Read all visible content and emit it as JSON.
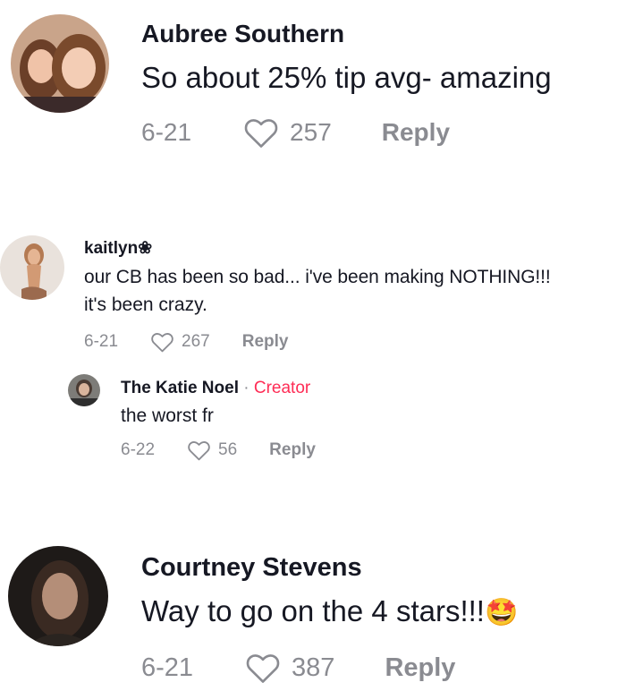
{
  "comments": [
    {
      "username": "Aubree Southern",
      "text": "So about 25% tip avg- amazing",
      "date": "6-21",
      "likes": "257",
      "reply_label": "Reply"
    },
    {
      "username": "kaitlyn❀",
      "text_lines": [
        "our CB has been so bad... i've been making NOTHING!!!",
        "it's been crazy."
      ],
      "date": "6-21",
      "likes": "267",
      "reply_label": "Reply",
      "replies": [
        {
          "username": "The Katie Noel",
          "separator": "·",
          "badge": "Creator",
          "text": "the worst fr",
          "date": "6-22",
          "likes": "56",
          "reply_label": "Reply"
        }
      ]
    },
    {
      "username": "Courtney Stevens",
      "text": "Way to go on the 4 stars!!!",
      "emoji": "🤩",
      "date": "6-21",
      "likes": "387",
      "reply_label": "Reply"
    }
  ],
  "colors": {
    "text": "#161823",
    "muted": "#8a8b91",
    "creator": "#fe2c55"
  },
  "icons": {
    "like": "heart-outline-icon",
    "emoji": "star-struck-emoji"
  }
}
